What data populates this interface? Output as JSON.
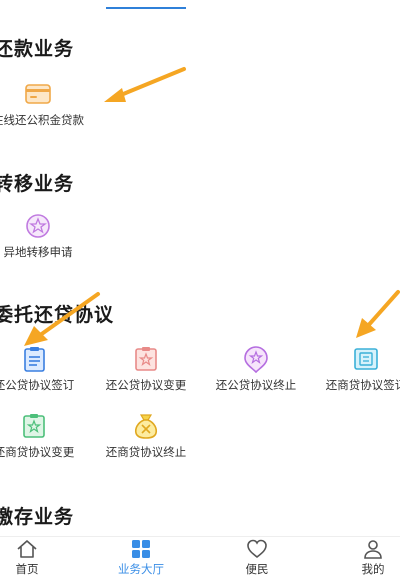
{
  "sections": [
    {
      "title": "还款业务"
    },
    {
      "title": "转移业务"
    },
    {
      "title": "委托还贷协议"
    },
    {
      "title": "缴存业务"
    }
  ],
  "repay": {
    "items": [
      {
        "label": "在线还公积金贷款",
        "icon": "card-icon"
      }
    ]
  },
  "transfer": {
    "items": [
      {
        "label": "异地转移申请",
        "icon": "transfer-icon"
      }
    ]
  },
  "agreement": {
    "items": [
      {
        "label": "还公贷协议签订",
        "icon": "document-icon"
      },
      {
        "label": "还公贷协议变更",
        "icon": "change-icon"
      },
      {
        "label": "还公贷协议终止",
        "icon": "terminate-icon"
      },
      {
        "label": "还商贷协议签订",
        "icon": "document-icon"
      },
      {
        "label": "还商贷协议变更",
        "icon": "change-icon"
      },
      {
        "label": "还商贷协议终止",
        "icon": "money-bag-icon"
      }
    ]
  },
  "nav": {
    "home": "首页",
    "hall": "业务大厅",
    "service": "便民",
    "mine": "我的"
  },
  "colors": {
    "accent": "#3a8ee6",
    "arrow": "#f5a623",
    "orange": "#f0a848",
    "pink": "#e88a88",
    "purple": "#b56ee0",
    "cyan": "#3ab0d8"
  }
}
